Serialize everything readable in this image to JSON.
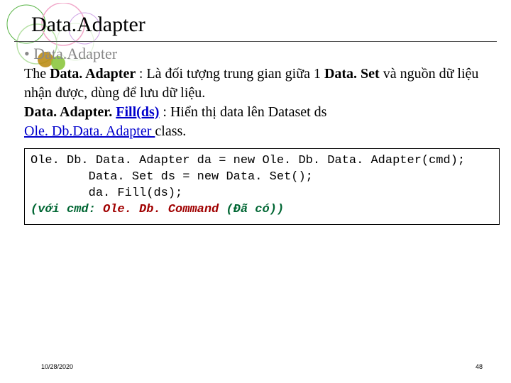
{
  "title": "Data.Adapter",
  "bullet_heading": "• Data.Adapter",
  "body": {
    "the_label": "The ",
    "data_adapter_bold": "Data. Adapter ",
    "desc1": ": Là đối tượng trung gian giữa 1 ",
    "data_set_bold": "Data. Set",
    "desc2": " và nguồn dữ liệu nhận được, dùng để lưu dữ liệu.",
    "fill_bold": "Data. Adapter. ",
    "fill_link": "Fill(ds)",
    "fill_desc": " : Hiển thị data lên Dataset ds",
    "ole_link": "Ole. Db.Data. Adapter ",
    "class_text": "class."
  },
  "code": {
    "l1": "Ole. Db. Data. Adapter da = new Ole. Db. Data. Adapter(cmd);",
    "l2": "        Data. Set ds = new Data. Set();",
    "l3": "        da. Fill(ds);",
    "l4_a": "(với cmd: ",
    "l4_b": "Ole. Db. Command ",
    "l4_c": "(Đã có)",
    "l4_d": ")"
  },
  "footer": {
    "date": "10/28/2020",
    "page": "48"
  }
}
